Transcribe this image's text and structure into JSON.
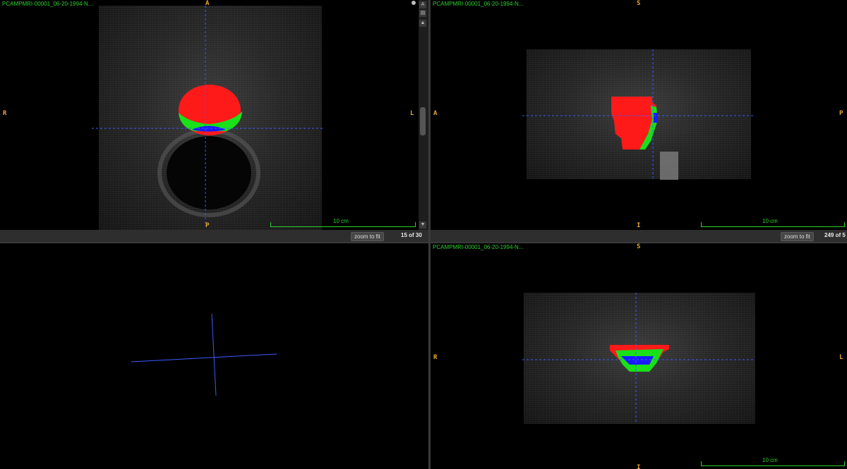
{
  "viewer": {
    "axial": {
      "title": "PCAMPMRI-00001_06-20-1994-N...",
      "orient_top": "A",
      "orient_bottom": "P",
      "orient_left": "R",
      "orient_right": "L",
      "scale_label": "10 cm",
      "zoom_button": "zoom to fit",
      "slice_label": "15 of 30"
    },
    "sagittal": {
      "title": "PCAMPMRI-00001_06-20-1994-N...",
      "orient_top": "S",
      "orient_bottom": "I",
      "orient_left": "A",
      "orient_right": "P",
      "scale_label": "10 cm",
      "zoom_button": "zoom to fit",
      "slice_label": "249 of 5"
    },
    "coronal": {
      "title": "PCAMPMRI-00001_06-20-1994-N...",
      "orient_top": "S",
      "orient_bottom": "I",
      "orient_left": "R",
      "orient_right": "L",
      "scale_label": "10 cm"
    },
    "scrollbar": {
      "btn_a": "A",
      "btn_b": "▤",
      "btn_up": "▲",
      "btn_down": "▼"
    },
    "segment_colors": {
      "red": "#ff1a1a",
      "green": "#19e019",
      "blue": "#1a1aff"
    },
    "crosshair_color": "#3b5bff"
  }
}
